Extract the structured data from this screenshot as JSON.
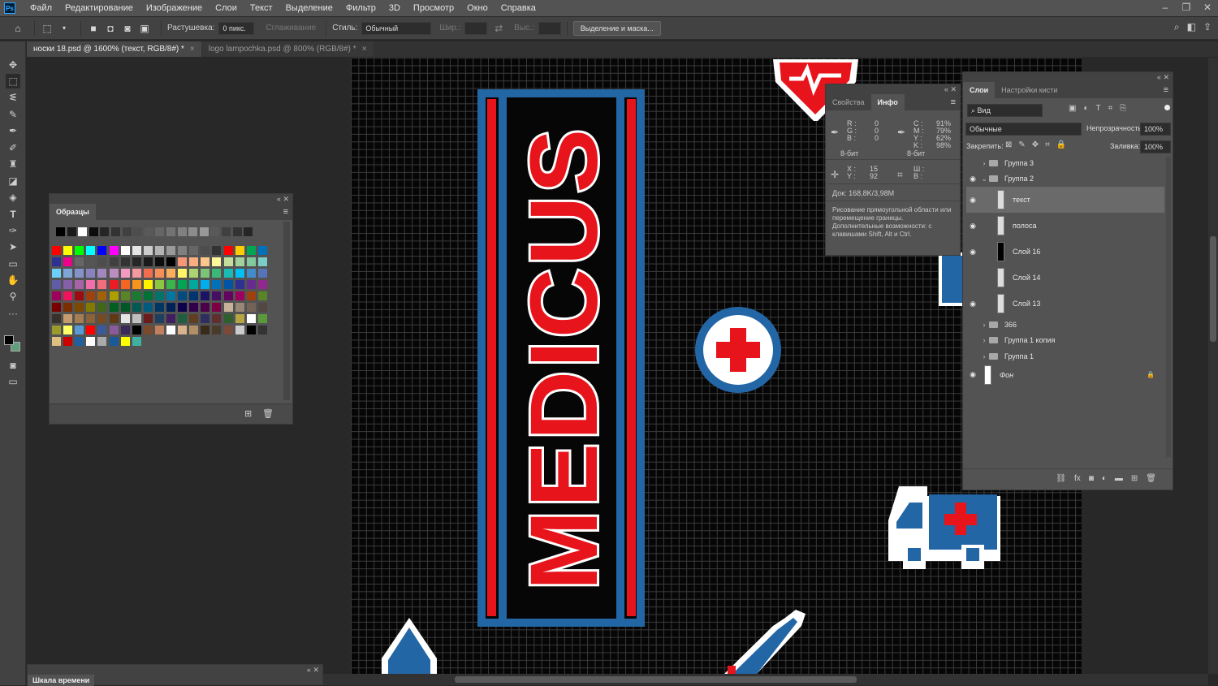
{
  "app": {
    "logo": "Ps"
  },
  "menu": [
    "Файл",
    "Редактирование",
    "Изображение",
    "Слои",
    "Текст",
    "Выделение",
    "Фильтр",
    "3D",
    "Просмотр",
    "Окно",
    "Справка"
  ],
  "options": {
    "feather_label": "Растушевка:",
    "feather_value": "0 пикс.",
    "antialias_label": "Сглаживание",
    "style_label": "Стиль:",
    "style_value": "Обычный",
    "width_label": "Шир.:",
    "height_label": "Выс.:",
    "select_mask": "Выделение и маска..."
  },
  "tabs": [
    {
      "label": "носки 18.psd @ 1600% (текст, RGB/8#) *",
      "close": "×"
    },
    {
      "label": "logo lampochka.psd @ 800% (RGB/8#) *",
      "close": "×"
    }
  ],
  "swatches_panel": {
    "title": "Образцы"
  },
  "swatch_colors": {
    "gray_row": [
      "#000000",
      "#1a1a1a",
      "#ffffff",
      "#0d0d0d",
      "#262626",
      "#333333",
      "#404040",
      "#4d4d4d",
      "#595959",
      "#666666",
      "#737373",
      "#808080",
      "#8c8c8c",
      "#999999",
      "#595959",
      "#404040",
      "#333333",
      "#262626"
    ],
    "rows": [
      [
        "#ff0000",
        "#ffff00",
        "#00ff00",
        "#00ffff",
        "#0000ff",
        "#ff00ff",
        "#ffffff",
        "#e6e6e6",
        "#cccccc",
        "#b3b3b3",
        "#999999",
        "#808080",
        "#666666",
        "#4d4d4d",
        "#333333",
        "#ff0000",
        "#ffcc00",
        "#00a651",
        "#0072bc"
      ],
      [
        "#2e3192",
        "#ec008c",
        "#666666",
        "#555555",
        "#4d4d4d",
        "#404040",
        "#333333",
        "#262626",
        "#1a1a1a",
        "#0d0d0d",
        "#000000",
        "#f7977a",
        "#f9ad81",
        "#fdc68a",
        "#fff79a",
        "#c4df9b",
        "#a3d39c",
        "#82ca9d",
        "#7bcdc8"
      ],
      [
        "#6ecff6",
        "#7ea7d8",
        "#8493ca",
        "#8882be",
        "#a187be",
        "#bc8dbf",
        "#f49ac2",
        "#f6989d",
        "#f26c4f",
        "#f68e55",
        "#fbaf5c",
        "#fff467",
        "#acd372",
        "#7cc576",
        "#3bb878",
        "#1abbb4",
        "#00bff3",
        "#438ccb",
        "#5574b9"
      ],
      [
        "#605ca8",
        "#855fa8",
        "#a763a8",
        "#f06ea9",
        "#f26d7d",
        "#ed1c24",
        "#f26522",
        "#f7941d",
        "#fff200",
        "#8dc73f",
        "#39b54a",
        "#00a651",
        "#00a99d",
        "#00aeef",
        "#0072bc",
        "#0054a6",
        "#2e3192",
        "#662d91",
        "#92278f"
      ],
      [
        "#9e005d",
        "#ed145b",
        "#9e0b0f",
        "#a0410d",
        "#a36209",
        "#aba000",
        "#598527",
        "#1a7b30",
        "#007236",
        "#00746b",
        "#0076a3",
        "#004b80",
        "#003471",
        "#1b1464",
        "#440e62",
        "#630460",
        "#9e005d",
        "#a0410d",
        "#598527"
      ],
      [
        "#790000",
        "#7b2e00",
        "#7d4900",
        "#827b00",
        "#406618",
        "#005e20",
        "#005826",
        "#005952",
        "#005b7f",
        "#003663",
        "#002157",
        "#0d004c",
        "#32004b",
        "#4b0049",
        "#7b0046",
        "#c7b299",
        "#998675",
        "#736357",
        "#534741"
      ],
      [
        "#37302d",
        "#c69c6d",
        "#a67c52",
        "#8c6239",
        "#754c24",
        "#603913",
        "#e5e5e5",
        "#bfbfbf",
        "#6a1b1b",
        "#1f3f5f",
        "#3f1f5f",
        "#1f5f3f",
        "#5f3f1f",
        "#2f2f5f",
        "#5f2f2f",
        "#2f5f2f",
        "#b5a642",
        "#ffffff",
        "#5b9a3a"
      ],
      [
        "#9b9b2b",
        "#ffff66",
        "#5b9bd5",
        "#ff0000",
        "#3a5a9a",
        "#8a5a9a",
        "#3a2a5a",
        "#000000",
        "#7a4a2a",
        "#c08060",
        "#ffffff",
        "#d9b38c",
        "#b38f66",
        "#3a2a1a",
        "#4a3a2a",
        "#7a4a3a",
        "#cccccc",
        "#000000",
        "#333333"
      ],
      [
        "#e0c080",
        "#cc0000",
        "#2060a0",
        "#ffffff",
        "#aaaaaa",
        "#1a5a9a",
        "#ffff00",
        "#40b0a0"
      ]
    ]
  },
  "info_panel": {
    "tab1": "Свойства",
    "tab2": "Инфо",
    "r": "R :",
    "g": "G :",
    "b": "B :",
    "r_val": "0",
    "g_val": "0",
    "b_val": "0",
    "c": "C :",
    "m": "M :",
    "y": "Y :",
    "k": "K :",
    "c_val": "91%",
    "m_val": "79%",
    "y_val": "62%",
    "k_val": "98%",
    "bit1": "8-бит",
    "bit2": "8-бит",
    "x": "X :",
    "y_lbl": "Y :",
    "x_val": "15",
    "y_val2": "92",
    "w": "Ш :",
    "h": "В :",
    "doc": "Док: 168,8K/3,98M",
    "hint": "Рисование прямоугольной области или перемещение границы. Дополнительные возможности: с клавишами Shift, Alt и Ctrl."
  },
  "layers_panel": {
    "tab1": "Слои",
    "tab2": "Настройки кисти",
    "search": "Вид",
    "blend": "Обычные",
    "opacity_label": "Непрозрачность:",
    "opacity": "100%",
    "lock_label": "Закрепить:",
    "fill_label": "Заливка:",
    "fill": "100%",
    "layers": [
      {
        "name": "Группа 3",
        "visible": false,
        "type": "group",
        "chev": "›"
      },
      {
        "name": "Группа 2",
        "visible": true,
        "type": "group",
        "chev": "⌄"
      },
      {
        "name": "текст",
        "visible": true,
        "type": "layer",
        "selected": true
      },
      {
        "name": "полоса",
        "visible": true,
        "type": "layer"
      },
      {
        "name": "Слой 16",
        "visible": true,
        "type": "layer"
      },
      {
        "name": "Слой 14",
        "visible": false,
        "type": "layer"
      },
      {
        "name": "Слой 13",
        "visible": true,
        "type": "layer"
      },
      {
        "name": "366",
        "visible": false,
        "type": "group",
        "chev": "›"
      },
      {
        "name": "Группа 1 копия",
        "visible": false,
        "type": "group",
        "chev": "›"
      },
      {
        "name": "Группа 1",
        "visible": false,
        "type": "group",
        "chev": "›"
      },
      {
        "name": "Фон",
        "visible": true,
        "type": "background"
      }
    ]
  },
  "timeline": {
    "title": "Шкала времени"
  },
  "artwork": {
    "word": "MEDICUS"
  },
  "colors": {
    "red": "#e8141c",
    "blue": "#2366a6",
    "white": "#ffffff"
  }
}
